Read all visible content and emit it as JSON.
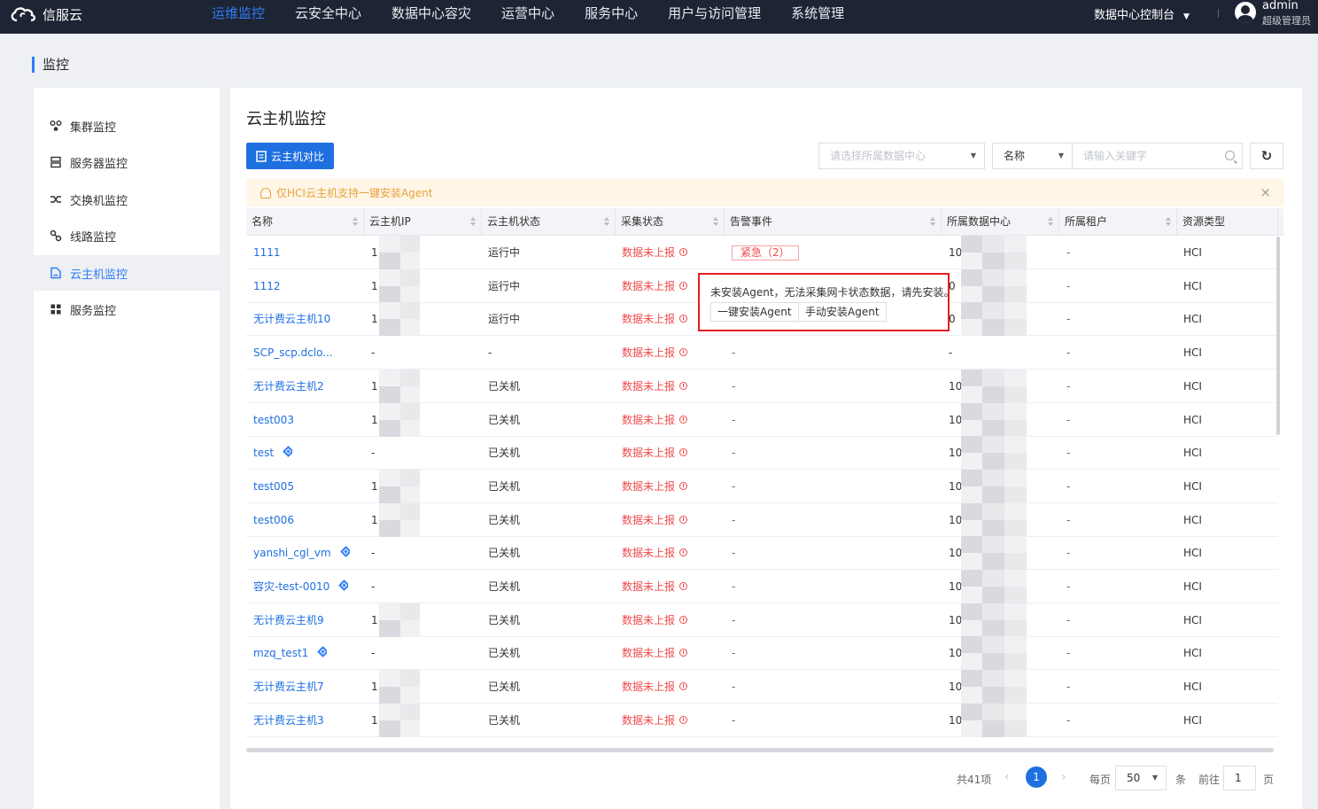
{
  "app": {
    "brand": "信服云"
  },
  "nav": [
    {
      "label": "运维监控",
      "active": true
    },
    {
      "label": "云安全中心"
    },
    {
      "label": "数据中心容灾"
    },
    {
      "label": "运营中心"
    },
    {
      "label": "服务中心"
    },
    {
      "label": "用户与访问管理"
    },
    {
      "label": "系统管理"
    }
  ],
  "header": {
    "console": "数据中心控制台",
    "username": "admin",
    "role": "超级管理员"
  },
  "page": {
    "title": "监控"
  },
  "sidebar": {
    "items": [
      {
        "label": "集群监控",
        "icon": "cluster-icon"
      },
      {
        "label": "服务器监控",
        "icon": "server-icon"
      },
      {
        "label": "交换机监控",
        "icon": "switch-icon"
      },
      {
        "label": "线路监控",
        "icon": "link-icon"
      },
      {
        "label": "云主机监控",
        "icon": "vm-icon",
        "active": true
      },
      {
        "label": "服务监控",
        "icon": "service-icon"
      }
    ]
  },
  "main": {
    "title": "云主机监控",
    "compare_button": "云主机对比",
    "dc_placeholder": "请选择所属数据中心",
    "field_select": "名称",
    "keyword_placeholder": "请输入关键字",
    "notice": "仅HCI云主机支持一键安装Agent"
  },
  "table": {
    "columns": [
      "名称",
      "云主机IP",
      "云主机状态",
      "采集状态",
      "告警事件",
      "所属数据中心",
      "所属租户",
      "资源类型"
    ],
    "rows": [
      {
        "name": "1111",
        "ip": "1",
        "status": "运行中",
        "collect": "数据未上报",
        "alert": "紧急（2）",
        "alert_badge": true,
        "dc": "10",
        "tenant": "-",
        "type": "HCI"
      },
      {
        "name": "1112",
        "ip": "1",
        "status": "运行中",
        "collect": "数据未上报",
        "alert": "-",
        "dc": "0",
        "tenant": "-",
        "type": "HCI"
      },
      {
        "name": "无计费云主机10",
        "ip": "1",
        "status": "运行中",
        "collect": "数据未上报",
        "alert": "-",
        "dc": "0",
        "tenant": "-",
        "type": "HCI"
      },
      {
        "name": "SCP_scp.dclo...",
        "ip": "-",
        "status": "-",
        "collect": "数据未上报",
        "alert": "-",
        "dc": "-",
        "tenant": "-",
        "type": "HCI"
      },
      {
        "name": "无计费云主机2",
        "ip": "1",
        "status": "已关机",
        "collect": "数据未上报",
        "alert": "-",
        "dc": "10",
        "tenant": "-",
        "type": "HCI"
      },
      {
        "name": "test003",
        "ip": "1",
        "status": "已关机",
        "collect": "数据未上报",
        "alert": "-",
        "dc": "10",
        "tenant": "-",
        "type": "HCI"
      },
      {
        "name": "test",
        "ip": "-",
        "status": "已关机",
        "collect": "数据未上报",
        "alert": "-",
        "dc": "10",
        "tenant": "-",
        "type": "HCI",
        "diamond": true
      },
      {
        "name": "test005",
        "ip": "1",
        "status": "已关机",
        "collect": "数据未上报",
        "alert": "-",
        "dc": "10",
        "tenant": "-",
        "type": "HCI"
      },
      {
        "name": "test006",
        "ip": "1",
        "status": "已关机",
        "collect": "数据未上报",
        "alert": "-",
        "dc": "10",
        "tenant": "-",
        "type": "HCI"
      },
      {
        "name": "yanshi_cgl_vm",
        "ip": "-",
        "status": "已关机",
        "collect": "数据未上报",
        "alert": "-",
        "dc": "10",
        "tenant": "-",
        "type": "HCI",
        "diamond": true
      },
      {
        "name": "容灾-test-0010",
        "ip": "-",
        "status": "已关机",
        "collect": "数据未上报",
        "alert": "-",
        "dc": "10",
        "tenant": "-",
        "type": "HCI",
        "diamond": true
      },
      {
        "name": "无计费云主机9",
        "ip": "1",
        "status": "已关机",
        "collect": "数据未上报",
        "alert": "-",
        "dc": "10",
        "tenant": "-",
        "type": "HCI"
      },
      {
        "name": "mzq_test1",
        "ip": "-",
        "status": "已关机",
        "collect": "数据未上报",
        "alert": "-",
        "dc": "10",
        "tenant": "-",
        "type": "HCI",
        "diamond": true
      },
      {
        "name": "无计费云主机7",
        "ip": "1",
        "status": "已关机",
        "collect": "数据未上报",
        "alert": "-",
        "dc": "10",
        "tenant": "-",
        "type": "HCI"
      },
      {
        "name": "无计费云主机3",
        "ip": "1",
        "status": "已关机",
        "collect": "数据未上报",
        "alert": "-",
        "dc": "10",
        "tenant": "-",
        "type": "HCI"
      }
    ]
  },
  "popover": {
    "message": "未安装Agent，无法采集网卡状态数据，请先安装。",
    "install_one_click": "一键安装Agent",
    "install_manual": "手动安装Agent"
  },
  "pagination": {
    "total": "共41项",
    "prev": "‹",
    "current": "1",
    "next": "›",
    "per_page_label": "每页",
    "page_size": "50",
    "unit": "条",
    "goto_label": "前往",
    "goto_value": "1",
    "page_suffix": "页"
  },
  "colors": {
    "topbar": "#1d2433",
    "accent": "#1e6fe0",
    "danger": "#f04a4a",
    "warning": "#e6a23c"
  }
}
